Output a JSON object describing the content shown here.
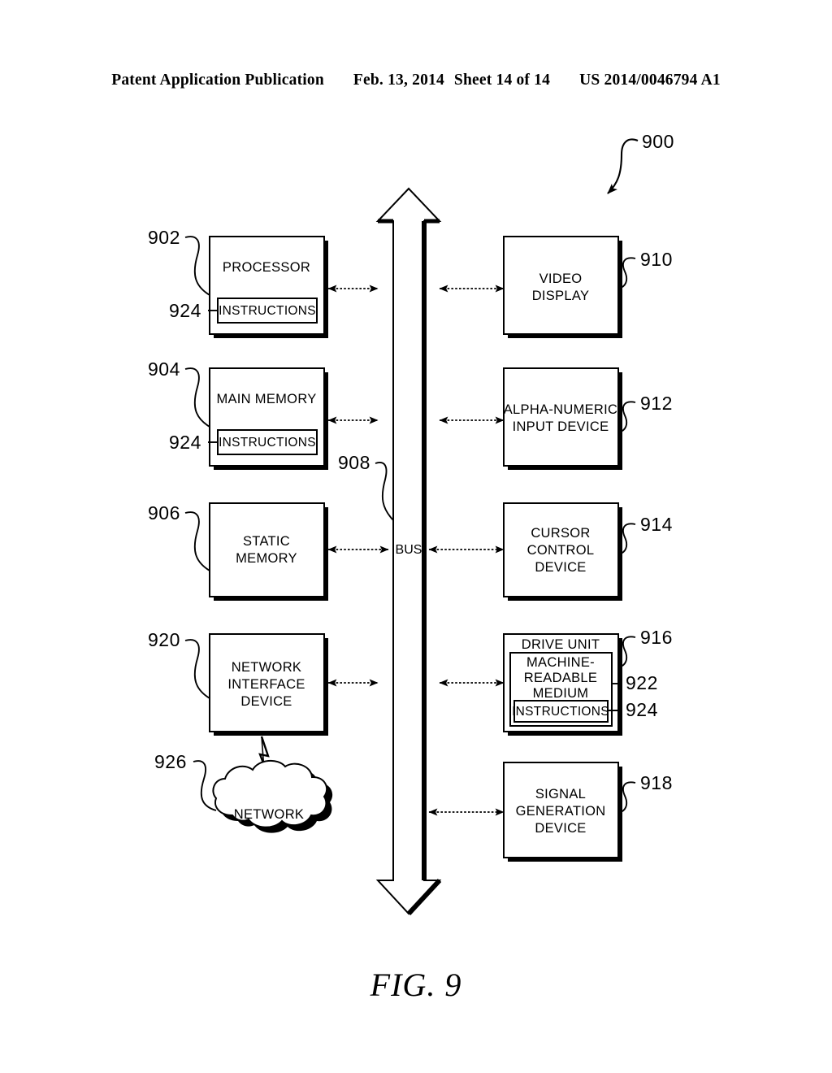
{
  "header": {
    "publication": "Patent Application Publication",
    "date": "Feb. 13, 2014",
    "sheet": "Sheet 14 of 14",
    "patent_number": "US 2014/0046794 A1"
  },
  "figure": {
    "caption": "FIG. 9",
    "system_ref": "900",
    "bus": {
      "label": "BUS",
      "ref": "908"
    }
  },
  "blocks": {
    "processor": {
      "label": "PROCESSOR",
      "ref": "902",
      "inner_label": "INSTRUCTIONS",
      "inner_ref": "924"
    },
    "main_memory": {
      "label": "MAIN MEMORY",
      "ref": "904",
      "inner_label": "INSTRUCTIONS",
      "inner_ref": "924"
    },
    "static_memory": {
      "line1": "STATIC",
      "line2": "MEMORY",
      "ref": "906"
    },
    "network_interface": {
      "line1": "NETWORK",
      "line2": "INTERFACE",
      "line3": "DEVICE",
      "ref": "920"
    },
    "network_cloud": {
      "label": "NETWORK",
      "ref": "926"
    },
    "video_display": {
      "line1": "VIDEO",
      "line2": "DISPLAY",
      "ref": "910"
    },
    "alpha_numeric": {
      "line1": "ALPHA-NUMERIC",
      "line2": "INPUT DEVICE",
      "ref": "912"
    },
    "cursor_control": {
      "line1": "CURSOR",
      "line2": "CONTROL",
      "line3": "DEVICE",
      "ref": "914"
    },
    "drive_unit": {
      "label": "DRIVE UNIT",
      "ref": "916"
    },
    "machine_readable": {
      "line1": "MACHINE-",
      "line2": "READABLE",
      "line3": "MEDIUM",
      "ref": "922"
    },
    "drive_instructions": {
      "label": "INSTRUCTIONS",
      "ref": "924"
    },
    "signal_generation": {
      "line1": "SIGNAL",
      "line2": "GENERATION",
      "line3": "DEVICE",
      "ref": "918"
    }
  },
  "colors": {
    "ink": "#000000",
    "paper": "#ffffff",
    "shadow": "#000000"
  }
}
